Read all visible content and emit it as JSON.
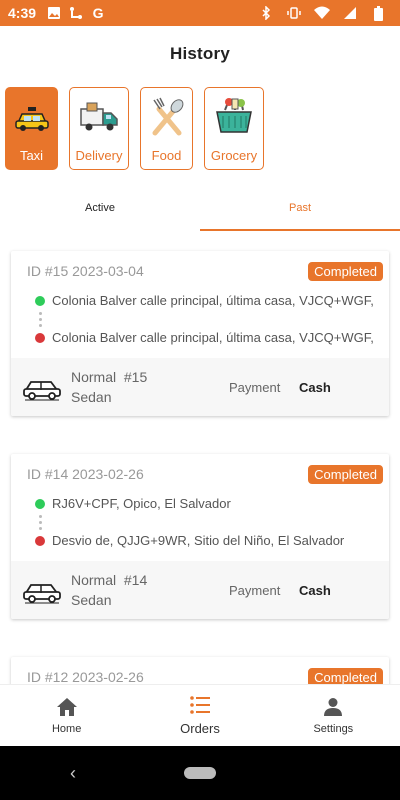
{
  "status_bar": {
    "time": "4:39",
    "left_icons": [
      "image-icon",
      "route-icon",
      "google-icon"
    ],
    "right_icons": [
      "bluetooth-icon",
      "vibrate-icon",
      "wifi-icon",
      "signal-icon",
      "battery-icon"
    ],
    "google_letter": "G"
  },
  "header": {
    "title": "History"
  },
  "categories": [
    {
      "label": "Taxi",
      "icon": "taxi-icon",
      "active": true
    },
    {
      "label": "Delivery",
      "icon": "delivery-truck-icon",
      "active": false
    },
    {
      "label": "Food",
      "icon": "food-utensils-icon",
      "active": false
    },
    {
      "label": "Grocery",
      "icon": "grocery-basket-icon",
      "active": false
    }
  ],
  "tabs": [
    {
      "label": "Active",
      "active": false
    },
    {
      "label": "Past",
      "active": true
    }
  ],
  "orders": [
    {
      "id": "ID #15 2023-03-04",
      "status": "Completed",
      "pickup": "Colonia Balver calle principal, última casa, VJCQ+WGF,",
      "dropoff": "Colonia Balver calle principal, última casa, VJCQ+WGF,",
      "service": "Normal  #15",
      "vehicle": "Sedan",
      "payment_label": "Payment",
      "payment_value": "Cash"
    },
    {
      "id": "ID #14 2023-02-26",
      "status": "Completed",
      "pickup": "RJ6V+CPF, Opico, El Salvador",
      "dropoff": "Desvio de, QJJG+9WR, Sitio del Niño, El Salvador",
      "service": "Normal  #14",
      "vehicle": "Sedan",
      "payment_label": "Payment",
      "payment_value": "Cash"
    },
    {
      "id": "ID #12 2023-02-26",
      "status": "Completed"
    }
  ],
  "bottom_nav": [
    {
      "label": "Home",
      "icon": "home-icon",
      "active": false
    },
    {
      "label": "Orders",
      "icon": "list-icon",
      "active": true
    },
    {
      "label": "Settings",
      "icon": "person-icon",
      "active": false
    }
  ],
  "colors": {
    "accent": "#e8752b",
    "green": "#2ecc5a",
    "red": "#d9383a"
  }
}
